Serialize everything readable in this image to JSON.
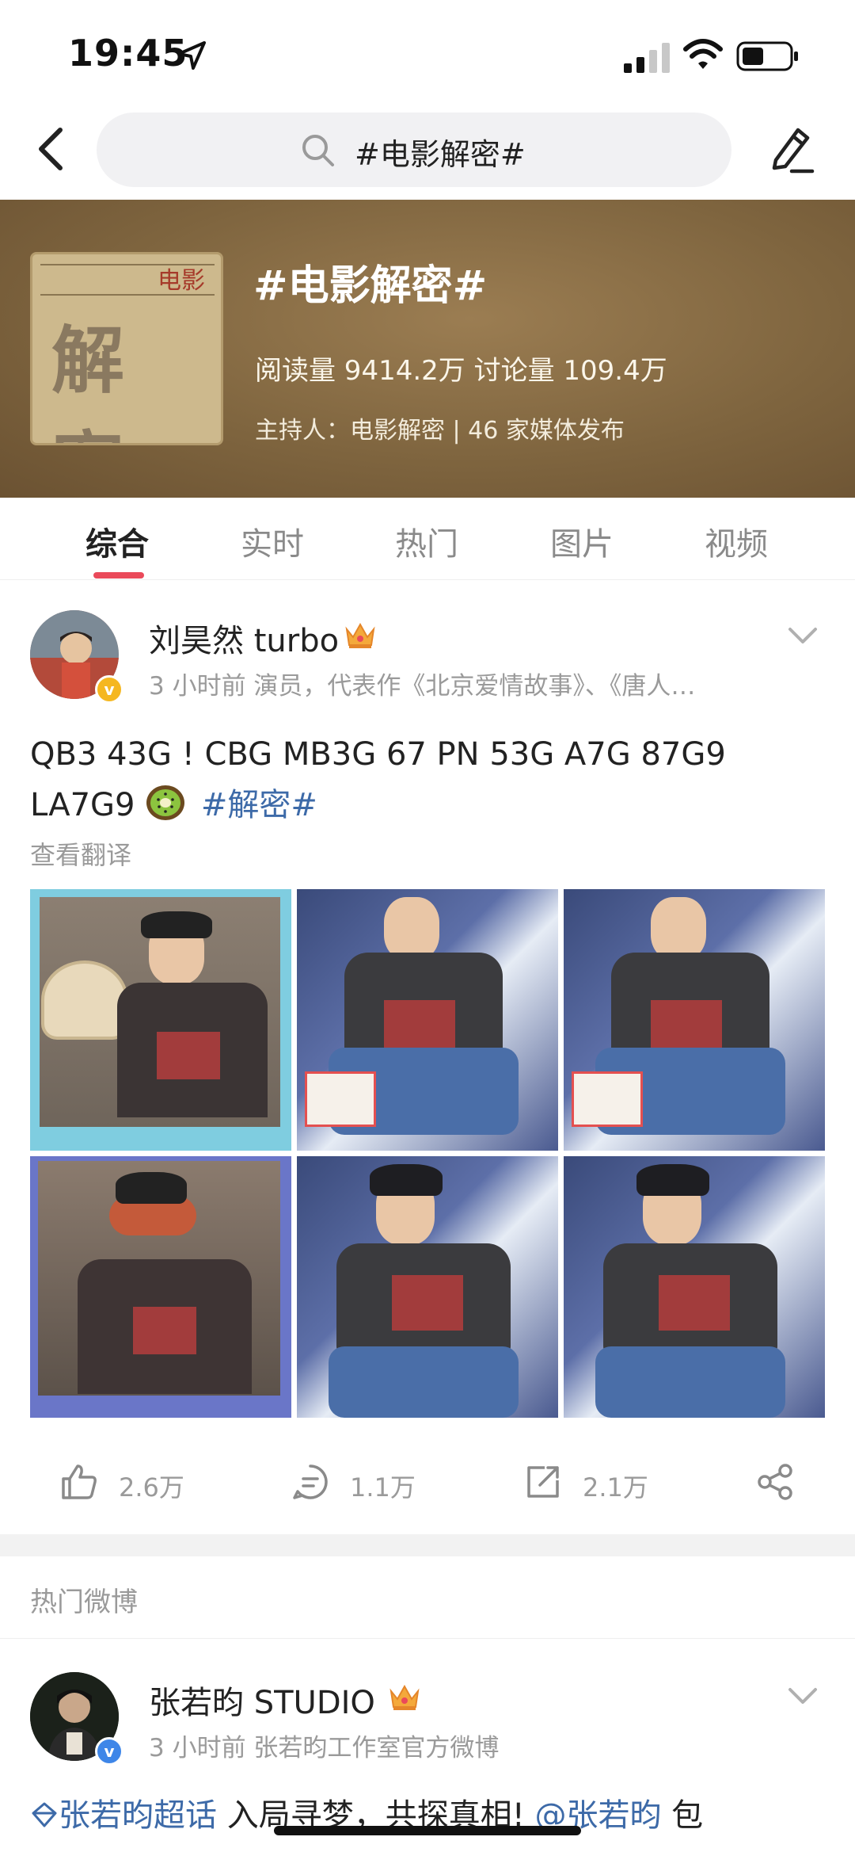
{
  "status_bar": {
    "time": "19:45",
    "icons": [
      "location-arrow-icon",
      "signal-icon",
      "wifi-icon",
      "battery-icon"
    ]
  },
  "nav": {
    "back_icon": "chevron-left-icon",
    "search_text": "#电影解密#",
    "edit_icon": "pencil-icon"
  },
  "topic": {
    "title": "#电影解密#",
    "stats": "阅读量 9414.2万  讨论量 109.4万",
    "host": "主持人：电影解密 | 46 家媒体发布",
    "cover": {
      "glyph": "解 密",
      "stamp": "电影"
    },
    "background_color": "#7f653f"
  },
  "tabs": [
    {
      "label": "综合",
      "active": true
    },
    {
      "label": "实时",
      "active": false
    },
    {
      "label": "热门",
      "active": false
    },
    {
      "label": "图片",
      "active": false
    },
    {
      "label": "视频",
      "active": false
    }
  ],
  "post": {
    "author": "刘昊然 turbo",
    "meta": "3 小时前   演员，代表作《北京爱情故事》、《唐人…",
    "text_line1": "QB3 43G ! CBG MB3G 67 PN 53G A7G 87G9",
    "text_line2_prefix": "LA7G9",
    "hashtag": "#解密#",
    "translate": "查看翻译",
    "photos": [
      "photo-1",
      "photo-2",
      "photo-3",
      "photo-4",
      "photo-5",
      "photo-6"
    ],
    "likes": "2.6万",
    "comments": "1.1万",
    "reposts": "2.1万"
  },
  "hot_section": {
    "label": "热门微博"
  },
  "post2": {
    "author": "张若昀 STUDIO",
    "meta": "3 小时前   张若昀工作室官方微博",
    "text_link1": "张若昀超话",
    "text_mid": " 入局寻梦，共探真相! ",
    "text_link2": "@张若昀",
    "text_end": " 包"
  },
  "colors": {
    "accent": "#ea4a5a",
    "link": "#3d6aa8",
    "verified": "#f5b720",
    "muted": "#9a9a9a"
  }
}
